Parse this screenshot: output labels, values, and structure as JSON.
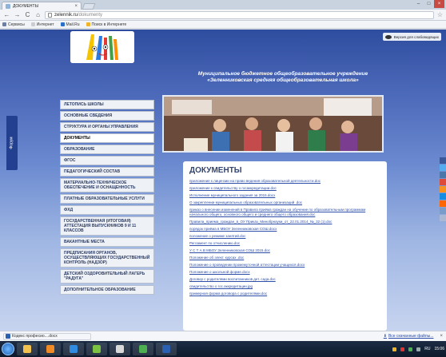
{
  "browser": {
    "tab_title": "ДОКУМЕНТЫ",
    "url_host": "zelennik.ru",
    "url_path": "/dokumenty",
    "bookmarks": [
      {
        "label": "Сервисы",
        "color": "#6a7fa8"
      },
      {
        "label": "Интернет",
        "color": "#c9ccd2"
      },
      {
        "label": "Mail.Ru",
        "color": "#2a70c8"
      },
      {
        "label": "Поиск в Интернете",
        "color": "#f0b429"
      }
    ]
  },
  "header": {
    "vision_label": "Версия для слабовидящих",
    "school_name_line1": "Муниципальное бюджетное общеобразовательное учреждение",
    "school_name_line2": "«Зеленниковская средняя общеобразовательная школа»"
  },
  "forum_label": "Форум",
  "menu": [
    {
      "label": "ЛЕТОПИСЬ ШКОЛЫ",
      "active": false
    },
    {
      "label": "ОСНОВНЫЕ СВЕДЕНИЯ",
      "active": false
    },
    {
      "label": "СТРУКТУРА И ОРГАНЫ УПРАВЛЕНИЯ",
      "active": false
    },
    {
      "label": "ДОКУМЕНТЫ",
      "active": true
    },
    {
      "label": "ОБРАЗОВАНИЕ",
      "active": false
    },
    {
      "label": "ФГОС",
      "active": false
    },
    {
      "label": "ПЕДАГОГИЧЕСКИЙ СОСТАВ",
      "active": false
    },
    {
      "label": "МАТЕРИАЛЬНО-ТЕХНИЧЕСКОЕ ОБЕСПЕЧЕНИЕ И ОСНАЩЕННОСТЬ",
      "active": false
    },
    {
      "label": "ПЛАТНЫЕ ОБРАЗОВАТЕЛЬНЫЕ УСЛУГИ",
      "active": false
    },
    {
      "label": "ФХД",
      "active": false
    },
    {
      "label": "ГОСУДАРСТВЕННАЯ (ИТОГОВАЯ) АТТЕСТАЦИЯ ВЫПУСКНИКОВ 9 И 11 КЛАССОВ",
      "active": false
    },
    {
      "label": "ВАКАНТНЫЕ МЕСТА",
      "active": false
    },
    {
      "label": "ПРЕДПИСАНИЯ ОРГАНОВ, ОСУЩЕСТВЛЯЮЩИХ ГОСУДАРСТВЕННЫЙ КОНТРОЛЬ (НАДЗОР)",
      "active": false
    },
    {
      "label": "ДЕТСКИЙ ОЗДОРОВИТЕЛЬНЫЙ ЛАГЕРЬ \"РАДУГА\"",
      "active": false
    },
    {
      "label": "ДОПОЛНИТЕЛЬНОЕ ОБРАЗОВАНИЕ",
      "active": false
    }
  ],
  "content": {
    "title": "ДОКУМЕНТЫ",
    "documents": [
      "приложение к лицензии на право ведения образовательной деятельности.doc",
      "приложение к свидетельству о госаккредитации.doc",
      "Исполнение муниципального задания за 2015.docx",
      "О закреплении муниципальных образовательных организаций .doc",
      "приказ о внесении изменений в Правила приёма граждан на обучение по образовательным программам начального общего, основного общего и среднего общего образования.doc",
      "Правила_приема_граждан_в_ОУ Приказ_Минобрнауки_от_22.01.2014_№_32 (1).doc",
      "порядок приёма в МБОУ Зеленниковская СОШ.docx",
      "положение о режиме занятий.doc",
      "Регламент по отчислению.doc",
      "У С Т А В МБОУ Зеленниковская СОШ 2015.doc",
      "Положение об элект. курсах .doc",
      "Положение о проведении промежуточной аттестации учащихся.docx",
      "Положение о школьной форме.docx",
      "Договор с родителями воспитанников дет. сада.doc",
      "свидетельство о гос.аккредитации.jpg",
      "примерная форма договора с родителями.doc"
    ]
  },
  "social_colors": [
    "#3b5998",
    "#55acee",
    "#4a76a8",
    "#dd4b39",
    "#f7931e",
    "#168de2",
    "#ff6600",
    "#7b9cc9",
    "#aab8d4"
  ],
  "download": {
    "file_label": "Кодекс професио....docx",
    "show_all": "Все скачанные файлы..."
  },
  "taskbar": {
    "apps": [
      {
        "icon": "folder-icon",
        "color": "#f2c14e"
      },
      {
        "icon": "player-icon",
        "color": "#f08a24"
      },
      {
        "icon": "ie-icon",
        "color": "#2f8be0"
      },
      {
        "icon": "paint-icon",
        "color": "#7cc242"
      },
      {
        "icon": "presentation-icon",
        "color": "#d9d9d9"
      },
      {
        "icon": "chrome-icon",
        "color": "#4caf50"
      },
      {
        "icon": "word-icon",
        "color": "#2b5fb2"
      }
    ],
    "language": "RU",
    "time": "15:06"
  }
}
